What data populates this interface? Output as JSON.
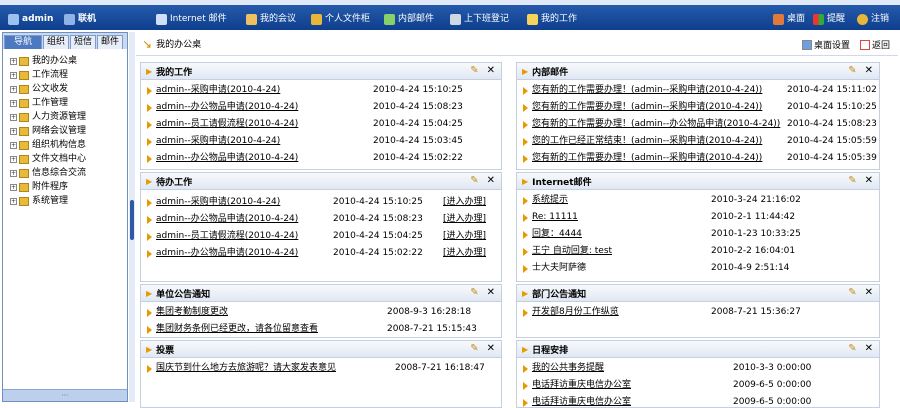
{
  "topbar": {
    "user": "admin",
    "status": "联机",
    "links": [
      "Internet 邮件",
      "我的会议",
      "个人文件柜",
      "内部邮件",
      "上下班登记",
      "我的工作"
    ],
    "right": [
      "桌面",
      "提醒",
      "注销"
    ]
  },
  "left": {
    "tabs": [
      "导航",
      "组织",
      "短信",
      "邮件"
    ],
    "tree": [
      "我的办公桌",
      "工作流程",
      "公文收发",
      "工作管理",
      "人力资源管理",
      "网络会议管理",
      "组织机构信息",
      "文件文档中心",
      "信息综合交流",
      "附件程序",
      "系统管理"
    ]
  },
  "main": {
    "title": "我的办公桌",
    "desk_settings": "桌面设置",
    "back": "返回"
  },
  "panels": {
    "mywork": {
      "title": "我的工作",
      "rows": [
        {
          "text": "admin--采购申请(2010-4-24)",
          "time": "2010-4-24 15:10:25"
        },
        {
          "text": "admin--办公物品申请(2010-4-24)",
          "time": "2010-4-24 15:08:23"
        },
        {
          "text": "admin--员工请假流程(2010-4-24)",
          "time": "2010-4-24 15:04:25"
        },
        {
          "text": "admin--采购申请(2010-4-24)",
          "time": "2010-4-24 15:03:45"
        },
        {
          "text": "admin--办公物品申请(2010-4-24)",
          "time": "2010-4-24 15:02:22"
        }
      ]
    },
    "inmail": {
      "title": "内部邮件",
      "rows": [
        {
          "text": "您有新的工作需要办理！(admin--采购申请(2010-4-24))",
          "time": "2010-4-24 15:11:02"
        },
        {
          "text": "您有新的工作需要办理！(admin--采购申请(2010-4-24))",
          "time": "2010-4-24 15:10:25"
        },
        {
          "text": "您有新的工作需要办理！(admin--办公物品申请(2010-4-24))",
          "time": "2010-4-24 15:08:23"
        },
        {
          "text": "您的工作已经正常结束！(admin--采购申请(2010-4-24))",
          "time": "2010-4-24 15:05:59"
        },
        {
          "text": "您有新的工作需要办理！(admin--采购申请(2010-4-24))",
          "time": "2010-4-24 15:05:39"
        }
      ]
    },
    "todo": {
      "title": "待办工作",
      "rows": [
        {
          "text": "admin--采购申请(2010-4-24)",
          "time": "2010-4-24 15:10:25",
          "action": "[进入办理]"
        },
        {
          "text": "admin--办公物品申请(2010-4-24)",
          "time": "2010-4-24 15:08:23",
          "action": "[进入办理]"
        },
        {
          "text": "admin--员工请假流程(2010-4-24)",
          "time": "2010-4-24 15:04:25",
          "action": "[进入办理]"
        },
        {
          "text": "admin--办公物品申请(2010-4-24)",
          "time": "2010-4-24 15:02:22",
          "action": "[进入办理]"
        }
      ]
    },
    "internet": {
      "title": "Internet邮件",
      "rows": [
        {
          "text": "系统提示",
          "time": "2010-3-24 21:16:02"
        },
        {
          "text": "Re: 11111",
          "time": "2010-2-1 11:44:42"
        },
        {
          "text": "回复：4444",
          "time": "2010-1-23 10:33:25"
        },
        {
          "text": "王宁 自动回复: test",
          "time": "2010-2-2 16:04:01"
        },
        {
          "text": "士大夫阿萨德",
          "time": "2010-4-9 2:51:14"
        }
      ]
    },
    "unit": {
      "title": "单位公告通知",
      "rows": [
        {
          "text": "集团考勤制度更改",
          "time": "2008-9-3 16:28:18"
        },
        {
          "text": "集团财务条例已经更改，请各位留意查看",
          "time": "2008-7-21 15:15:43"
        }
      ]
    },
    "dept": {
      "title": "部门公告通知",
      "rows": [
        {
          "text": "开发部8月份工作纵览",
          "time": "2008-7-21 15:36:27"
        }
      ]
    },
    "vote": {
      "title": "投票",
      "rows": [
        {
          "text": "国庆节到什么地方去旅游呢？请大家发表意见",
          "time": "2008-7-21 16:18:47"
        }
      ]
    },
    "schedule": {
      "title": "日程安排",
      "rows": [
        {
          "text": "我的公共事务提醒",
          "time": "2010-3-3 0:00:00"
        },
        {
          "text": "电话拜访重庆电信办公室",
          "time": "2009-6-5 0:00:00"
        },
        {
          "text": "电话拜访重庆电信办公室",
          "time": "2009-6-5 0:00:00"
        }
      ]
    }
  },
  "colors": {
    "topbar": "#1a4d9e",
    "accent": "#e69a00",
    "tab_active": "#4d79c0"
  }
}
